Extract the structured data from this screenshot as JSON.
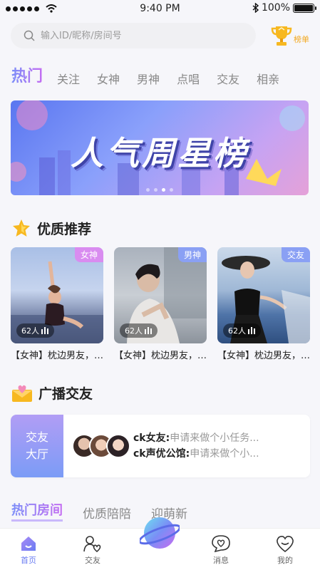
{
  "status": {
    "time": "9:40 PM",
    "battery": "100%",
    "battery_level": 1.0
  },
  "search": {
    "placeholder": "输入ID/昵称/房间号"
  },
  "rank": {
    "label": "榜单"
  },
  "tabs": [
    {
      "label": "热门",
      "active": true
    },
    {
      "label": "关注"
    },
    {
      "label": "女神"
    },
    {
      "label": "男神"
    },
    {
      "label": "点唱"
    },
    {
      "label": "交友"
    },
    {
      "label": "相亲"
    }
  ],
  "banner": {
    "title": "人气周星榜",
    "slide_count": 4,
    "active_slide": 3
  },
  "quality": {
    "title": "优质推荐"
  },
  "cards": [
    {
      "tag": "女神",
      "tag_color": "#d98cf0",
      "count": "62人",
      "caption": "【女神】枕边男友，说走就走的…"
    },
    {
      "tag": "男神",
      "tag_color": "#8aa0f4",
      "count": "62人",
      "caption": "【女神】枕边男友，说走就走的…"
    },
    {
      "tag": "交友",
      "tag_color": "#8aa0f4",
      "count": "62人",
      "caption": "【女神】枕边男友，说走就走的…"
    }
  ],
  "broadcast": {
    "title": "广播交友",
    "hall_line1": "交友",
    "hall_line2": "大厅",
    "messages": [
      {
        "name": "ck女友:",
        "text": "申请来做个小任务..."
      },
      {
        "name": "ck声优公馆:",
        "text": "申请来做个小..."
      }
    ]
  },
  "room_tabs": [
    {
      "label": "热门房间",
      "active": true
    },
    {
      "label": "优质陪陪"
    },
    {
      "label": "迎萌新"
    }
  ],
  "nav": [
    {
      "label": "首页",
      "icon": "home-icon",
      "active": true
    },
    {
      "label": "交友",
      "icon": "people-icon"
    },
    {
      "label": "",
      "icon": "planet-icon"
    },
    {
      "label": "消息",
      "icon": "chat-heart-icon"
    },
    {
      "label": "我的",
      "icon": "heart-icon"
    }
  ],
  "colors": {
    "accent": "#6a7cf2",
    "accent2": "#c56df2",
    "gold": "#f2a81f"
  }
}
